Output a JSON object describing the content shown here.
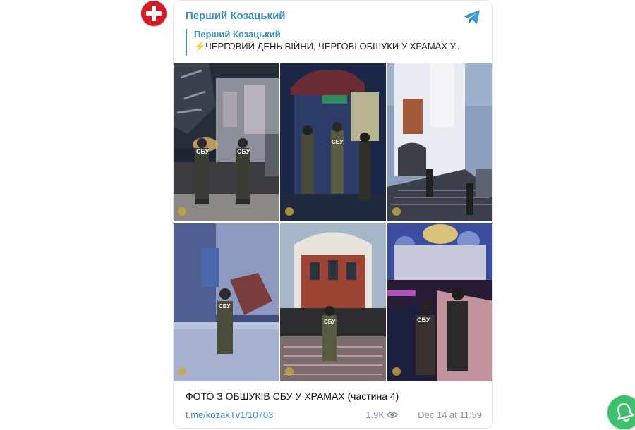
{
  "post": {
    "channel_name": "Перший Козацький",
    "reply": {
      "author": "Перший Козацький",
      "text": "⚡️ЧЕРГОВИЙ ДЕНЬ ВІЙНИ, ЧЕРГОВІ ОБШУКИ У ХРАМАХ У..."
    },
    "caption": "ФОТО З ОБШУКІВ СБУ У ХРАМАХ (частина 4)",
    "link": "t.me/kozakTv1/10703",
    "views": "1.9K",
    "date": "Dec 14 at 11:59"
  },
  "photos": [
    {
      "label": "СБУ"
    },
    {
      "label": "СБУ"
    },
    {
      "label": ""
    },
    {
      "label": "СБУ"
    },
    {
      "label": "СБУ"
    },
    {
      "label": "СБУ"
    }
  ],
  "colors": {
    "brand_red": "#d41a25",
    "telegram_blue": "#3a8dc5",
    "action_green": "#3cc16a"
  },
  "icons": {
    "avatar": "plus-cross-icon",
    "telegram": "telegram-plane-icon",
    "views": "eye-icon",
    "floating": "bell-icon"
  }
}
